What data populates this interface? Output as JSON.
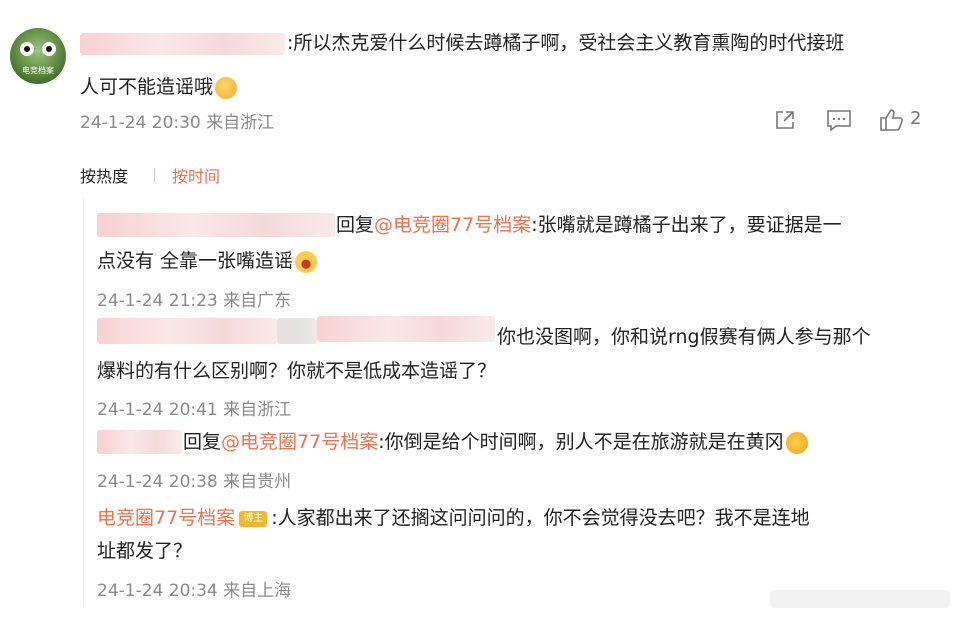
{
  "main_comment": {
    "text_line1": ":所以杰克爱什么时候去蹲橘子啊，受社会主义教育熏陶的时代接班",
    "text_line2": "人可不能造谣哦",
    "timestamp": "24-1-24 20:30",
    "location": "来自浙江",
    "like_count": "2",
    "avatar_caption": "电竞档案"
  },
  "sort": {
    "hot_label": "按热度",
    "time_label": "按时间",
    "active_color": "#eb7350"
  },
  "replies": [
    {
      "reply_word": "回复",
      "mention": "@电竞圈77号档案",
      "text_line1": ":张嘴就是蹲橘子出来了，要证据是一",
      "text_line2": "点没有 全靠一张嘴造谣",
      "timestamp": "24-1-24 21:23",
      "location": "来自广东"
    },
    {
      "text_line1": "你也没图啊，你和说rng假赛有俩人参与那个",
      "text_line2": "爆料的有什么区别啊？你就不是低成本造谣了？",
      "timestamp": "24-1-24 20:41",
      "location": "来自浙江"
    },
    {
      "reply_word": "回复",
      "mention": "@电竞圈77号档案",
      "text_line1": ":你倒是给个时间啊，别人不是在旅游就是在黄冈",
      "timestamp": "24-1-24 20:38",
      "location": "来自贵州"
    },
    {
      "author": "电竞圈77号档案",
      "badge": "博主",
      "text_line1": ":人家都出来了还搁这问问问的，你不会觉得没去吧？我不是连地",
      "text_line2": "址都发了？",
      "timestamp": "24-1-24 20:34",
      "location": "来自上海"
    }
  ],
  "icons": [
    "share-icon",
    "comment-icon",
    "like-icon"
  ],
  "colors": {
    "accent": "#eb7350",
    "meta": "#8a8a8a",
    "text": "#222222"
  }
}
